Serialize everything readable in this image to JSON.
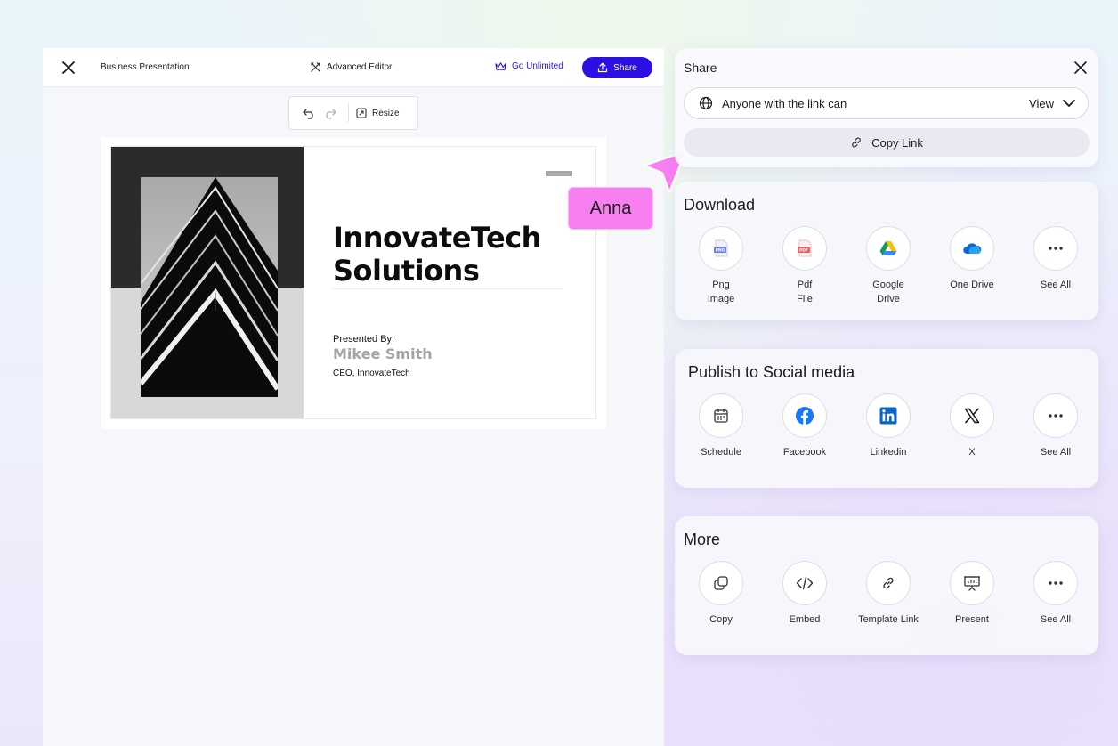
{
  "editor": {
    "doc_title": "Business Presentation",
    "advanced_editor": "Advanced Editor",
    "go_unlimited": "Go Unlimited",
    "share_label": "Share",
    "resize_label": "Resize"
  },
  "slide": {
    "title": "InnovateTech Solutions",
    "presented_by": "Presented By:",
    "presenter": "Mikee Smith",
    "role": "CEO, InnovateTech"
  },
  "collaborator": {
    "name": "Anna",
    "color": "#f77ff0"
  },
  "share": {
    "title": "Share",
    "access_text": "Anyone with the link can",
    "access_value": "View",
    "copy_link": "Copy Link"
  },
  "download": {
    "title": "Download",
    "items": [
      {
        "label": "Png\nImage",
        "icon": "png-file-icon"
      },
      {
        "label": "Pdf\nFile",
        "icon": "pdf-file-icon"
      },
      {
        "label": "Google\nDrive",
        "icon": "google-drive-icon"
      },
      {
        "label": "One Drive",
        "icon": "onedrive-icon"
      },
      {
        "label": "See All",
        "icon": "more-dots-icon"
      }
    ]
  },
  "social": {
    "title": "Publish to Social media",
    "items": [
      {
        "label": "Schedule",
        "icon": "calendar-icon"
      },
      {
        "label": "Facebook",
        "icon": "facebook-icon"
      },
      {
        "label": "Linkedin",
        "icon": "linkedin-icon"
      },
      {
        "label": "X",
        "icon": "x-logo-icon"
      },
      {
        "label": "See All",
        "icon": "more-dots-icon"
      }
    ]
  },
  "more": {
    "title": "More",
    "items": [
      {
        "label": "Copy",
        "icon": "copy-icon"
      },
      {
        "label": "Embed",
        "icon": "code-icon"
      },
      {
        "label": "Template Link",
        "icon": "link-icon"
      },
      {
        "label": "Present",
        "icon": "presentation-icon"
      },
      {
        "label": "See All",
        "icon": "more-dots-icon"
      }
    ]
  },
  "colors": {
    "accent": "#2c0fe3",
    "go_unlimited": "#2614e6",
    "cursor": "#f77ff0"
  }
}
